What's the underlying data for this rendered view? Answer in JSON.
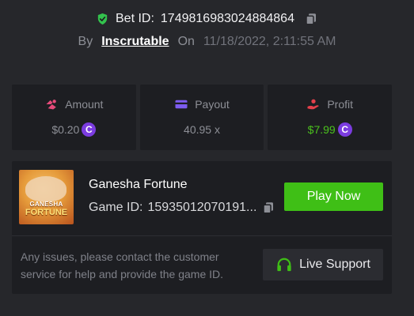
{
  "bet": {
    "label": "Bet ID:",
    "id": "1749816983024884864",
    "by_label": "By",
    "user": "Inscrutable",
    "on_label": "On",
    "date": "11/18/2022, 2:11:55 AM"
  },
  "stats": [
    {
      "label": "Amount",
      "value": "$0.20",
      "icon": "amount-icon",
      "coin": "C"
    },
    {
      "label": "Payout",
      "value": "40.95 x",
      "icon": "payout-icon"
    },
    {
      "label": "Profit",
      "value": "$7.99",
      "icon": "profit-icon",
      "coin": "C"
    }
  ],
  "game": {
    "name": "Ganesha Fortune",
    "thumb_line1": "GANESHA",
    "thumb_line2": "FORTUNE",
    "id_label": "Game ID:",
    "id_value": "15935012070191...",
    "play_label": "Play Now",
    "notice": "Any issues, please contact the customer service for help and provide the game ID.",
    "support_label": "Live Support"
  },
  "colors": {
    "accent_green": "#3fbf16",
    "profit_green": "#4bc11d",
    "coin_purple": "#7b3ce0",
    "amount_pink": "#e64b7a",
    "payout_purple": "#7d5cf0",
    "profit_red": "#e6404b"
  }
}
